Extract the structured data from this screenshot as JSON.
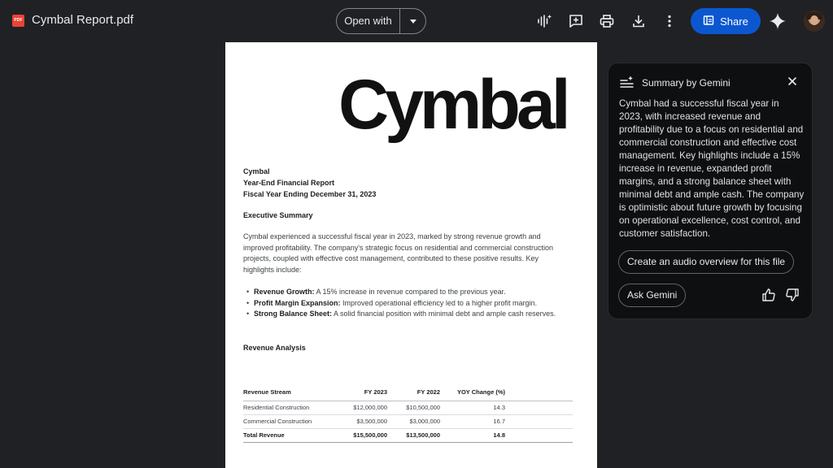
{
  "topbar": {
    "file_badge": "PDF",
    "file_title": "Cymbal Report.pdf",
    "open_with_label": "Open with",
    "share_label": "Share"
  },
  "icons": {
    "file": "pdf-file-icon",
    "audio": "audio-waveform-icon",
    "add_comment": "add-comment-icon",
    "print": "print-icon",
    "download": "download-icon",
    "more": "more-vert-icon",
    "share": "people-share-icon",
    "gemini": "gemini-sparkle-icon",
    "summary": "summary-list-icon",
    "close": "close-icon",
    "thumb_up": "thumb-up-icon",
    "thumb_down": "thumb-down-icon"
  },
  "colors": {
    "background": "#202124",
    "share_button": "#0b57d0",
    "pdf_badge": "#ea4335",
    "panel": "#0e0f11"
  },
  "document": {
    "logo": "Cymbal",
    "header_lines": [
      "Cymbal",
      "Year-End Financial Report",
      "Fiscal Year Ending December 31, 2023"
    ],
    "exec_summary_heading": "Executive Summary",
    "exec_summary_text": "Cymbal experienced a successful fiscal year in 2023, marked by strong revenue growth and improved profitability. The company's strategic focus on residential and commercial construction projects, coupled with effective cost management, contributed to these positive results. Key highlights include:",
    "highlights": [
      {
        "label": "Revenue Growth:",
        "text": " A 15% increase in revenue compared to the previous year."
      },
      {
        "label": "Profit Margin Expansion:",
        "text": " Improved operational efficiency led to a higher profit margin."
      },
      {
        "label": "Strong Balance Sheet:",
        "text": " A solid financial position with minimal debt and ample cash reserves."
      }
    ],
    "revenue_heading": "Revenue Analysis",
    "table": {
      "headers": [
        "Revenue Stream",
        "FY 2023",
        "FY 2022",
        "YOY Change (%)"
      ],
      "rows": [
        [
          "Residential Construction",
          "$12,000,000",
          "$10,500,000",
          "14.3"
        ],
        [
          "Commercial Construction",
          "$3,500,000",
          "$3,000,000",
          "16.7"
        ],
        [
          "Total Revenue",
          "$15,500,000",
          "$13,500,000",
          "14.8"
        ]
      ]
    }
  },
  "gemini_panel": {
    "title": "Summary by Gemini",
    "summary": "Cymbal had a successful fiscal year in 2023, with increased revenue and profitability due to a focus on residential and commercial construction and effective cost management. Key highlights include a 15% increase in revenue, expanded profit margins, and a strong balance sheet with minimal debt and ample cash. The company is optimistic about future growth by focusing on operational excellence, cost control, and customer satisfaction.",
    "audio_overview_label": "Create an audio overview for this file",
    "ask_label": "Ask Gemini"
  }
}
